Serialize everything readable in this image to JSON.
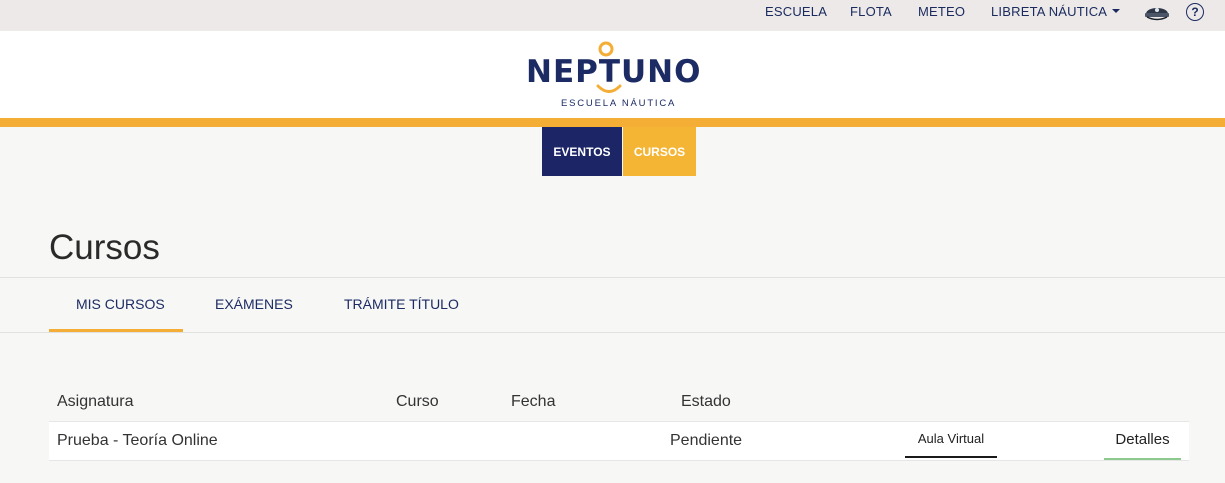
{
  "top_nav": {
    "items": [
      "ESCUELA",
      "FLOTA",
      "METEO"
    ],
    "libreta_label": "LIBRETA NÁUTICA",
    "help_symbol": "?",
    "icons": [
      "captain-hat-icon",
      "help-circle-icon",
      "caret-down-icon"
    ]
  },
  "brand": {
    "name": "NEPTUNO",
    "tagline": "ESCUELA NÁUTICA",
    "colors": {
      "navy": "#1c2b64",
      "accent": "#f5ae35"
    }
  },
  "sub_nav": {
    "eventos_label": "EVENTOS",
    "cursos_label": "CURSOS"
  },
  "page": {
    "title": "Cursos"
  },
  "tabs": [
    "MIS CURSOS",
    "EXÁMENES",
    "TRÁMITE TÍTULO"
  ],
  "table": {
    "headers": [
      "Asignatura",
      "Curso",
      "Fecha",
      "Estado"
    ],
    "rows": [
      {
        "asignatura": "Prueba - Teoría Online",
        "curso": "",
        "fecha": "",
        "estado": "Pendiente",
        "aula_label": "Aula Virtual",
        "detalles_label": "Detalles"
      }
    ]
  }
}
